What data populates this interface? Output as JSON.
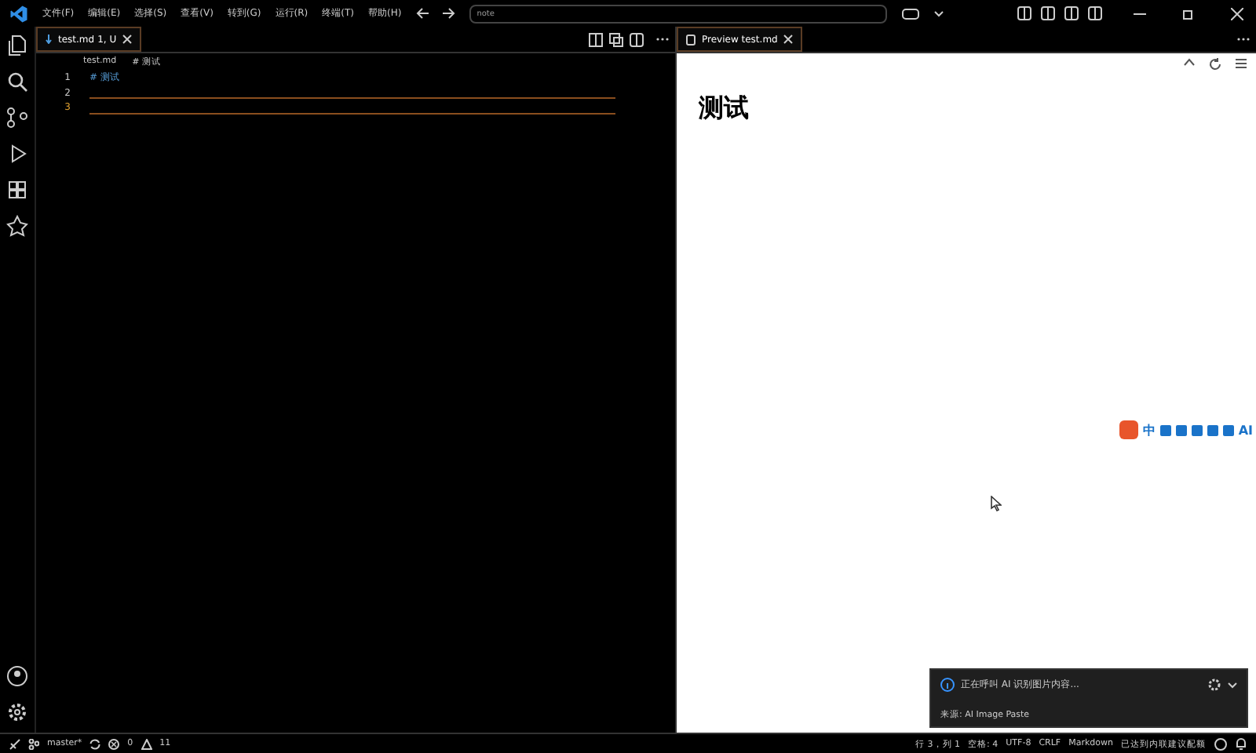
{
  "menu": [
    "文件(F)",
    "编辑(E)",
    "选择(S)",
    "查看(V)",
    "转到(G)",
    "运行(R)",
    "终端(T)",
    "帮助(H)"
  ],
  "search": {
    "value": "note"
  },
  "editor": {
    "tab": {
      "name": "test.md",
      "badge": "1, U",
      "selected": true
    },
    "breadcrumb": [
      "test.md",
      "# 测试"
    ],
    "lines": [
      {
        "number": "1",
        "text": "# 测试",
        "current": false
      },
      {
        "number": "2",
        "current": false
      },
      {
        "number": "3",
        "current": true
      }
    ]
  },
  "preview": {
    "tab": {
      "name": "Preview test.md",
      "selected": true
    },
    "heading": "测试"
  },
  "ime_toolbar": {
    "mode": "中",
    "ai": "AI"
  },
  "notification": {
    "message": "正在呼叫 AI 识别图片内容...",
    "source": "来源: AI Image Paste"
  },
  "status_bar": {
    "branch": "master*",
    "errors": "0",
    "warnings": "11",
    "right": [
      "行 3，列 1",
      "空格: 4",
      "UTF-8",
      "CRLF",
      "Markdown",
      "已达到内联建议配额"
    ]
  }
}
